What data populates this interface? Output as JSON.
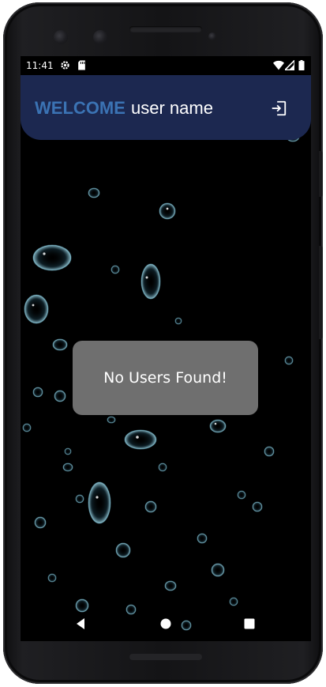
{
  "status_bar": {
    "time": "11:41",
    "left_icons": [
      "settings-icon",
      "sd-card-icon"
    ],
    "right_icons": [
      "wifi-icon",
      "signal-icon",
      "battery-icon"
    ]
  },
  "app_bar": {
    "welcome_label": "WELCOME",
    "user_name": "user name",
    "logout_icon": "logout-icon",
    "background_color": "#1c2850",
    "welcome_color": "#3b73b4"
  },
  "toast": {
    "message": "No Users Found!",
    "background_color": "#6f6f6f"
  },
  "navigation_bar": {
    "buttons": [
      "back-icon",
      "home-icon",
      "recents-icon"
    ]
  }
}
